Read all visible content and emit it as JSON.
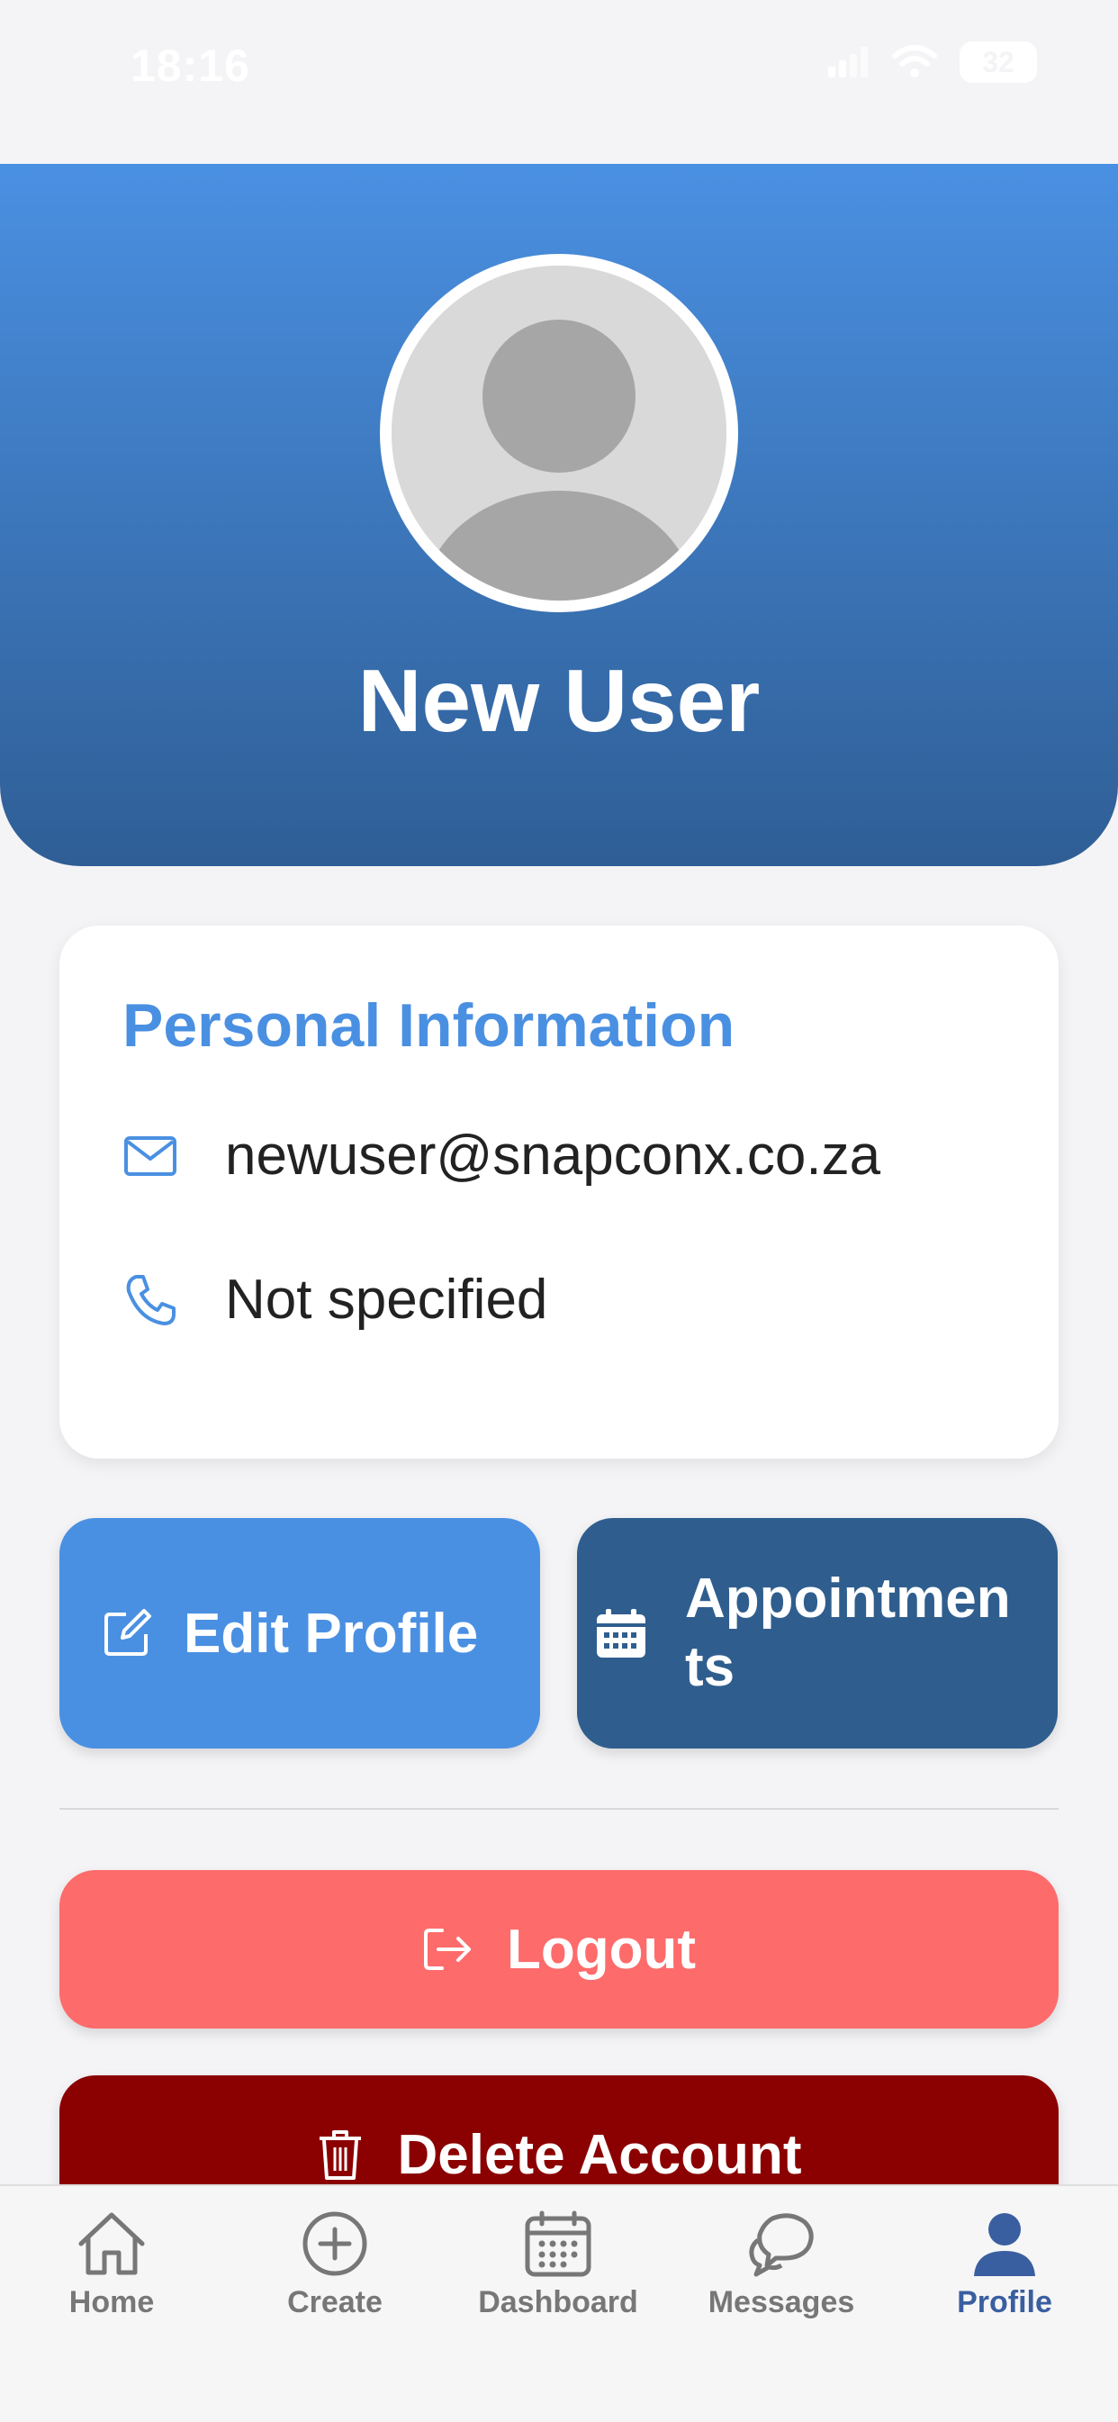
{
  "status_bar": {
    "time": "18:16",
    "battery": "32"
  },
  "profile": {
    "name": "New User"
  },
  "personal_info": {
    "title": "Personal Information",
    "email": "newuser@snapconx.co.za",
    "phone": "Not specified"
  },
  "actions": {
    "edit_profile": "Edit Profile",
    "appointments_line1": "Appointmen",
    "appointments_line2": "ts",
    "logout": "Logout",
    "delete_account": "Delete Account"
  },
  "tabs": [
    {
      "label": "Home",
      "icon": "home-icon"
    },
    {
      "label": "Create",
      "icon": "plus-circle-icon"
    },
    {
      "label": "Dashboard",
      "icon": "calendar-icon"
    },
    {
      "label": "Messages",
      "icon": "chat-bubbles-icon"
    },
    {
      "label": "Profile",
      "icon": "person-icon",
      "active": true
    }
  ],
  "colors": {
    "primary": "#4a90e2",
    "navy": "#2f5e8e",
    "logout": "#fe6b6b",
    "delete": "#8b0000"
  }
}
